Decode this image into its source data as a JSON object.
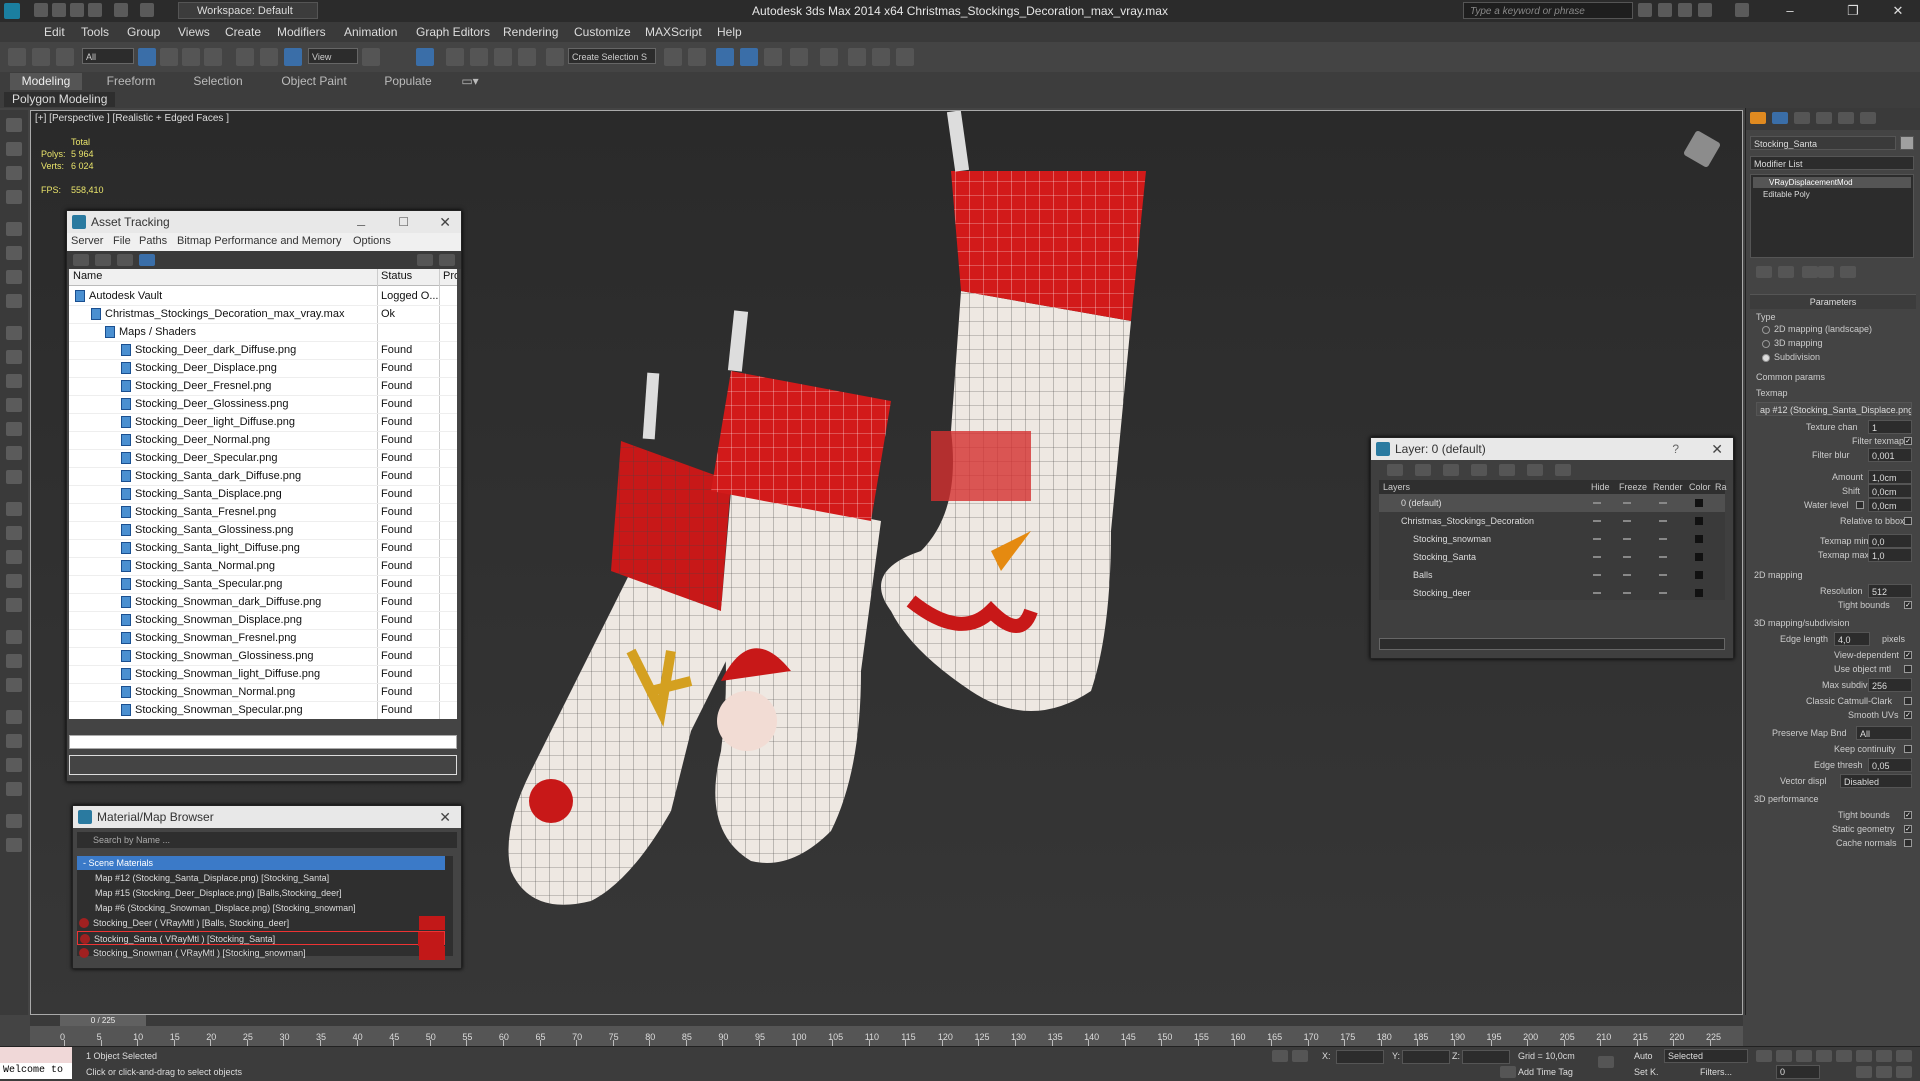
{
  "titlebar": {
    "workspace": "Workspace: Default",
    "title": "Autodesk 3ds Max  2014 x64     Christmas_Stockings_Decoration_max_vray.max",
    "search_placeholder": "Type a keyword or phrase"
  },
  "menubar": [
    "Edit",
    "Tools",
    "Group",
    "Views",
    "Create",
    "Modifiers",
    "Animation",
    "Graph Editors",
    "Rendering",
    "Customize",
    "MAXScript",
    "Help"
  ],
  "toolbar": {
    "filter": "All",
    "refcoord": "View",
    "named_selection": "Create Selection S"
  },
  "ribbon": {
    "tabs": [
      "Modeling",
      "Freeform",
      "Selection",
      "Object Paint",
      "Populate"
    ],
    "sub": "Polygon Modeling"
  },
  "viewport": {
    "label": "[+] [Perspective ] [Realistic + Edged Faces ]",
    "stats_total": "Total",
    "polys_label": "Polys:",
    "polys_value": "5 964",
    "verts_label": "Verts:",
    "verts_value": "6 024",
    "fps_label": "FPS:",
    "fps_value": "558,410"
  },
  "asset_tracking": {
    "title": "Asset Tracking",
    "menu": [
      "Server",
      "File",
      "Paths",
      "Bitmap Performance and Memory",
      "Options"
    ],
    "columns": [
      "Name",
      "Status",
      "Pro"
    ],
    "rows": [
      {
        "name": "Autodesk Vault",
        "status": "Logged O..."
      },
      {
        "name": "Christmas_Stockings_Decoration_max_vray.max",
        "status": "Ok"
      },
      {
        "name": "Maps / Shaders",
        "status": ""
      },
      {
        "name": "Stocking_Deer_dark_Diffuse.png",
        "status": "Found"
      },
      {
        "name": "Stocking_Deer_Displace.png",
        "status": "Found"
      },
      {
        "name": "Stocking_Deer_Fresnel.png",
        "status": "Found"
      },
      {
        "name": "Stocking_Deer_Glossiness.png",
        "status": "Found"
      },
      {
        "name": "Stocking_Deer_light_Diffuse.png",
        "status": "Found"
      },
      {
        "name": "Stocking_Deer_Normal.png",
        "status": "Found"
      },
      {
        "name": "Stocking_Deer_Specular.png",
        "status": "Found"
      },
      {
        "name": "Stocking_Santa_dark_Diffuse.png",
        "status": "Found"
      },
      {
        "name": "Stocking_Santa_Displace.png",
        "status": "Found"
      },
      {
        "name": "Stocking_Santa_Fresnel.png",
        "status": "Found"
      },
      {
        "name": "Stocking_Santa_Glossiness.png",
        "status": "Found"
      },
      {
        "name": "Stocking_Santa_light_Diffuse.png",
        "status": "Found"
      },
      {
        "name": "Stocking_Santa_Normal.png",
        "status": "Found"
      },
      {
        "name": "Stocking_Santa_Specular.png",
        "status": "Found"
      },
      {
        "name": "Stocking_Snowman_dark_Diffuse.png",
        "status": "Found"
      },
      {
        "name": "Stocking_Snowman_Displace.png",
        "status": "Found"
      },
      {
        "name": "Stocking_Snowman_Fresnel.png",
        "status": "Found"
      },
      {
        "name": "Stocking_Snowman_Glossiness.png",
        "status": "Found"
      },
      {
        "name": "Stocking_Snowman_light_Diffuse.png",
        "status": "Found"
      },
      {
        "name": "Stocking_Snowman_Normal.png",
        "status": "Found"
      },
      {
        "name": "Stocking_Snowman_Specular.png",
        "status": "Found"
      }
    ]
  },
  "material_browser": {
    "title": "Material/Map Browser",
    "search_placeholder": "Search by Name ...",
    "rows": [
      {
        "text": "- Scene Materials",
        "kind": "head"
      },
      {
        "text": "Map #12 (Stocking_Santa_Displace.png) [Stocking_Santa]",
        "kind": "map"
      },
      {
        "text": "Map #15 (Stocking_Deer_Displace.png) [Balls,Stocking_deer]",
        "kind": "map"
      },
      {
        "text": "Map #6 (Stocking_Snowman_Displace.png) [Stocking_snowman]",
        "kind": "map"
      },
      {
        "text": "Stocking_Deer  ( VRayMtl )  [Balls, Stocking_deer]",
        "kind": "mtl"
      },
      {
        "text": "Stocking_Santa  ( VRayMtl )  [Stocking_Santa]",
        "kind": "mtl-sel"
      },
      {
        "text": "Stocking_Snowman  ( VRayMtl )  [Stocking_snowman]",
        "kind": "mtl"
      }
    ]
  },
  "layer_panel": {
    "title": "Layer: 0 (default)",
    "help": "?",
    "columns": [
      "Layers",
      "Hide",
      "Freeze",
      "Render",
      "Color",
      "Ra"
    ],
    "rows": [
      "0 (default)",
      "Christmas_Stockings_Decoration",
      "Stocking_snowman",
      "Stocking_Santa",
      "Balls",
      "Stocking_deer"
    ]
  },
  "command_panel": {
    "object_name": "Stocking_Santa",
    "modifier_list": "Modifier List",
    "stack": [
      "VRayDisplacementMod",
      "Editable Poly"
    ],
    "rollout": "Parameters",
    "type_label": "Type",
    "types": [
      "2D mapping (landscape)",
      "3D mapping",
      "Subdivision"
    ],
    "common": "Common params",
    "texmap_label": "Texmap",
    "texmap_value": "ap #12 (Stocking_Santa_Displace.png)",
    "texture_chan": "Texture chan",
    "texture_chan_v": "1",
    "filter_texmap": "Filter texmap",
    "filter_blur": "Filter blur",
    "filter_blur_v": "0,001",
    "amount": "Amount",
    "amount_v": "1,0cm",
    "shift": "Shift",
    "shift_v": "0,0cm",
    "water": "Water level",
    "water_v": "0,0cm",
    "relbbox": "Relative to bbox",
    "tmin": "Texmap min",
    "tmin_v": "0,0",
    "tmax": "Texmap max",
    "tmax_v": "1,0",
    "map2d": "2D mapping",
    "resolution": "Resolution",
    "resolution_v": "512",
    "tight": "Tight bounds",
    "map3d": "3D mapping/subdivision",
    "edge_len": "Edge length",
    "edge_len_v": "4,0",
    "pixels": "pixels",
    "view_dep": "View-dependent",
    "use_obj": "Use object mtl",
    "max_subdivs": "Max subdivs",
    "max_subdivs_v": "256",
    "catmull": "Classic Catmull-Clark",
    "smooth_uv": "Smooth UVs",
    "preserve": "Preserve Map Bnd",
    "preserve_v": "All",
    "keep": "Keep continuity",
    "edge_thresh": "Edge thresh",
    "edge_thresh_v": "0,05",
    "vector": "Vector displ",
    "vector_v": "Disabled",
    "perf": "3D performance",
    "tight2": "Tight bounds",
    "static": "Static geometry",
    "cache": "Cache normals"
  },
  "timeline": {
    "slider": "0 / 225",
    "ticks": [
      "0",
      "5",
      "10",
      "15",
      "20",
      "25",
      "30",
      "35",
      "40",
      "45",
      "50",
      "55",
      "60",
      "65",
      "70",
      "75",
      "80",
      "85",
      "90",
      "95",
      "100",
      "105",
      "110",
      "115",
      "120",
      "125",
      "130",
      "135",
      "140",
      "145",
      "150",
      "155",
      "160",
      "165",
      "170",
      "175",
      "180",
      "185",
      "190",
      "195",
      "200",
      "205",
      "210",
      "215",
      "220",
      "225"
    ]
  },
  "statusbar": {
    "maxscript": "Welcome to",
    "selected": "1 Object Selected",
    "prompt": "Click or click-and-drag to select objects",
    "x": "X:",
    "y": "Y:",
    "z": "Z:",
    "grid": "Grid = 10,0cm",
    "add_time_tag": "Add Time Tag",
    "auto": "Auto",
    "selected_mode": "Selected",
    "setk": "Set K.",
    "filters": "Filters...",
    "frame": "0"
  }
}
